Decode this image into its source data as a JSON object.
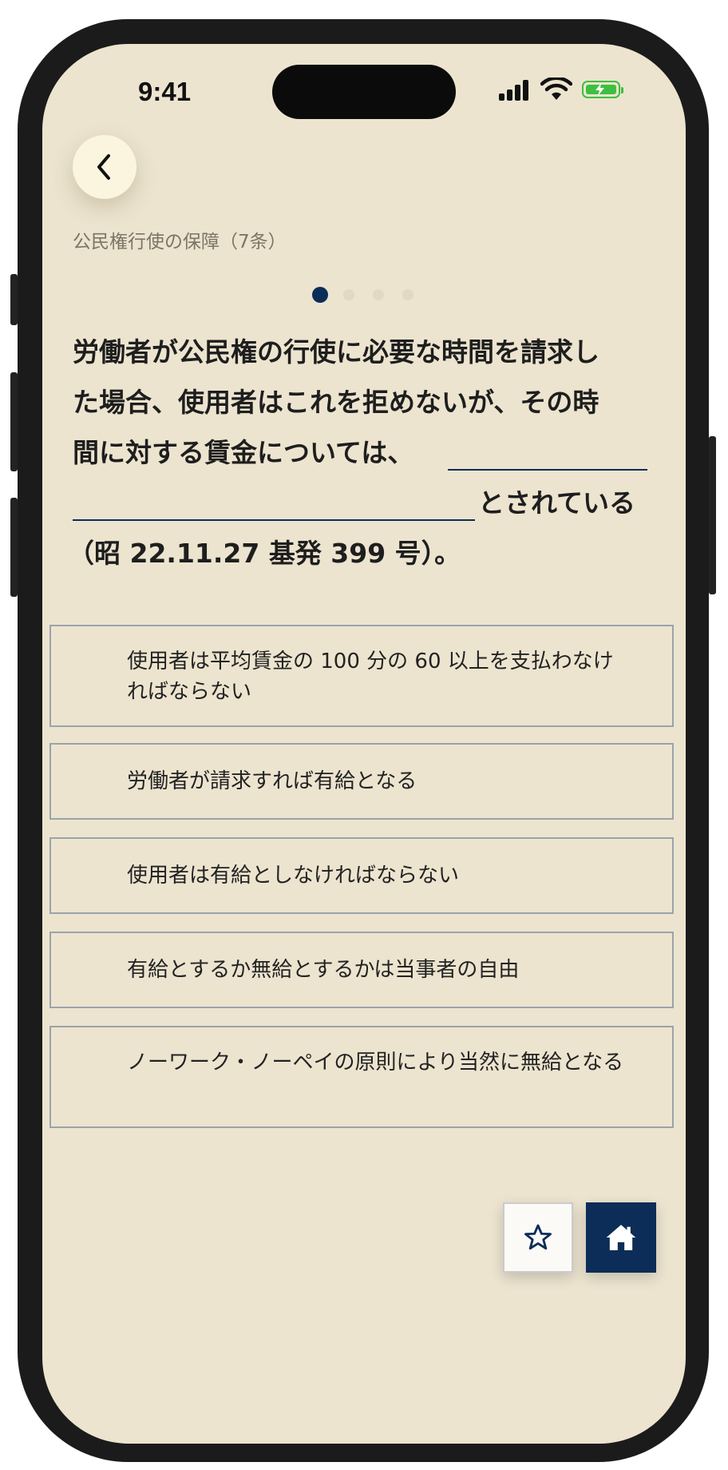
{
  "status_bar": {
    "time": "9:41"
  },
  "header": {
    "back_icon": "chevron-left-icon",
    "breadcrumb": "公民権行使の保障（7条）"
  },
  "pager": {
    "total": 4,
    "active_index": 0
  },
  "question": {
    "line1": "労働者が公民権の行使に必要な時間を請求し",
    "line2": "た場合、使用者はこれを拒めないが、その時",
    "line3": "間に対する賃金については、",
    "line4": "とされている",
    "line5": "（昭 22.11.27 基発 399 号）。"
  },
  "choices": [
    {
      "text": "使用者は平均賃金の 100 分の 60 以上を支払わなければならない"
    },
    {
      "text": "労働者が請求すれば有給となる"
    },
    {
      "text": "使用者は有給としなければならない"
    },
    {
      "text": "有給とするか無給とするかは当事者の自由"
    },
    {
      "text": "ノーワーク・ノーペイの原則により当然に無給となる"
    }
  ],
  "actions": {
    "favorite_icon": "star-outline-icon",
    "home_icon": "home-icon"
  },
  "colors": {
    "background": "#ece4cf",
    "accent": "#0c2d57",
    "border": "#9aa3ab"
  }
}
